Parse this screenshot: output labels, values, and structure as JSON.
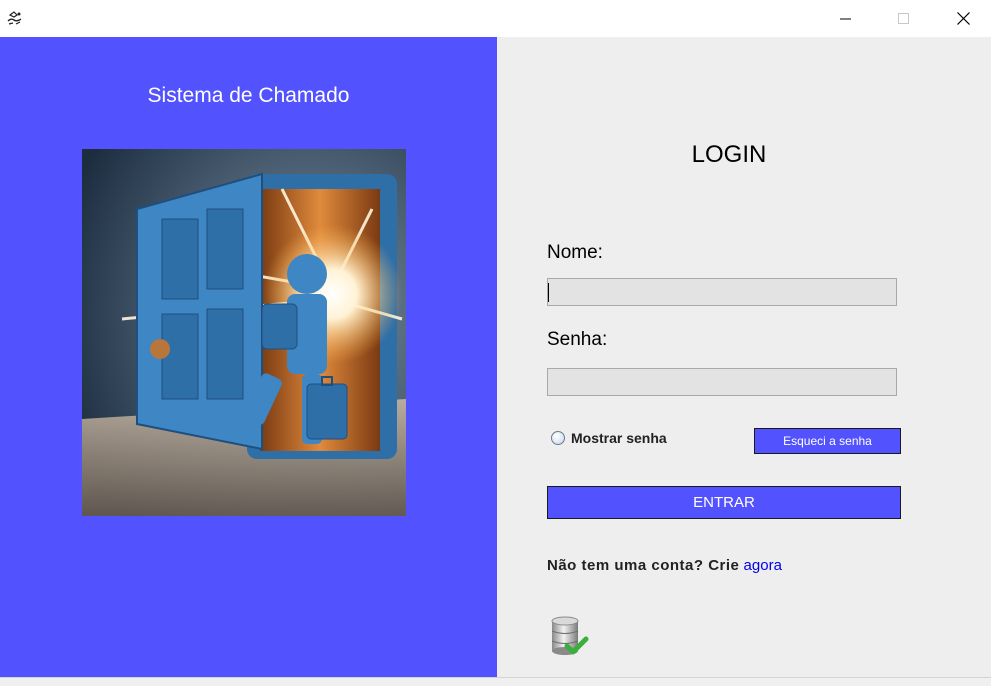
{
  "window": {
    "icons": {
      "app": "app-icon",
      "minimize": "minimize-icon",
      "maximize": "maximize-icon",
      "close": "close-icon"
    }
  },
  "left": {
    "title": "Sistema de Chamado",
    "background": "#5252ff",
    "image": "person-walking-through-glowing-door-illustration"
  },
  "login": {
    "title": "LOGIN",
    "name_label": "Nome:",
    "name_value": "",
    "password_label": "Senha:",
    "password_value": "",
    "show_password_label": "Mostrar senha",
    "show_password_checked": false,
    "forgot_label": "Esqueci a senha",
    "enter_label": "ENTRAR",
    "signup_text": "Não tem uma conta? Crie",
    "signup_link": "agora",
    "db_icon": "database-check-icon",
    "button_color": "#5252ff",
    "panel_color": "#eeeeee",
    "link_color": "#0000ee"
  }
}
